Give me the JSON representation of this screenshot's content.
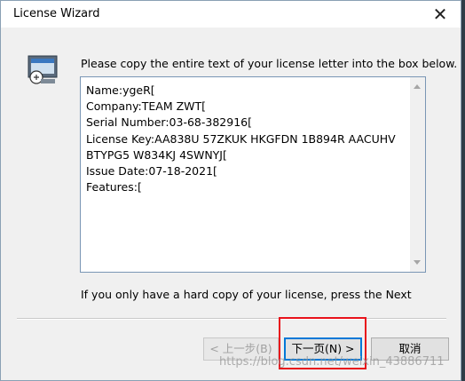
{
  "window": {
    "title": "License Wizard",
    "close_glyph": "✕"
  },
  "instruction": "Please copy the entire text of your license letter into the box below.",
  "license_text": {
    "lines": [
      "Name:ygeR[",
      "Company:TEAM ZWT[",
      "Serial Number:03-68-382916[",
      "License Key:AA838U 57ZKUK HKGFDN 1B894R AACUHV",
      "BTYPG5 W834KJ 4SWNYJ[",
      "Issue Date:07-18-2021[",
      "Features:["
    ]
  },
  "note": "If you only have a hard copy of your license, press the Next",
  "buttons": {
    "back": "< 上一步(B)",
    "next": "下一页(N) >",
    "cancel": "取消"
  },
  "watermark": "https://blog.csdn.net/weixin_43886711",
  "colors": {
    "highlight": "#e8121b",
    "focus_border": "#0078d7"
  }
}
